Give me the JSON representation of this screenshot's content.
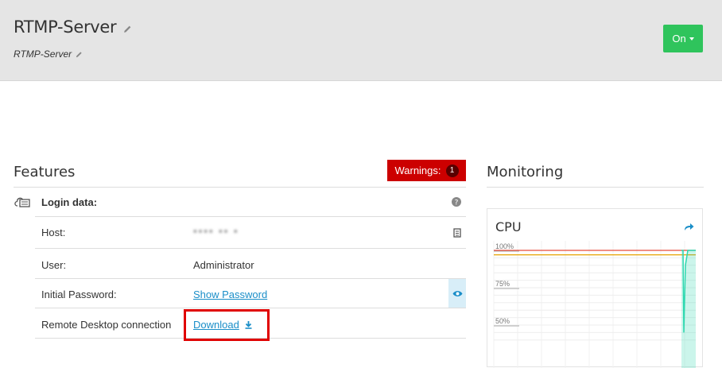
{
  "header": {
    "title": "RTMP-Server",
    "subtitle": "RTMP-Server",
    "power_button": "On"
  },
  "features": {
    "title": "Features",
    "warnings_label": "Warnings:",
    "warnings_count": "1",
    "login_data_label": "Login data:",
    "rows": [
      {
        "label": "Host:",
        "value": "▪▪▪▪ ▪▪ ▪"
      },
      {
        "label": "User:",
        "value": "Administrator"
      },
      {
        "label": "Initial Password:",
        "value": "Show Password"
      },
      {
        "label": "Remote Desktop connection",
        "value": "Download"
      }
    ]
  },
  "monitoring": {
    "title": "Monitoring",
    "cpu_title": "CPU"
  },
  "chart_data": {
    "type": "line",
    "title": "CPU",
    "yticks": [
      "100%",
      "75%",
      "50%"
    ],
    "ylim": [
      40,
      100
    ],
    "threshold_lines": [
      {
        "value": 100,
        "color": "#e74c3c"
      },
      {
        "value": 97,
        "color": "#e6a100"
      }
    ],
    "series": [
      {
        "values": [
          100,
          100,
          45,
          90,
          100,
          100
        ],
        "color": "#2ed8b0"
      }
    ]
  },
  "colors": {
    "on_button": "#2fc45c",
    "warnings": "#cc0000",
    "link": "#1a8ec8",
    "highlight_box": "#e00000"
  }
}
